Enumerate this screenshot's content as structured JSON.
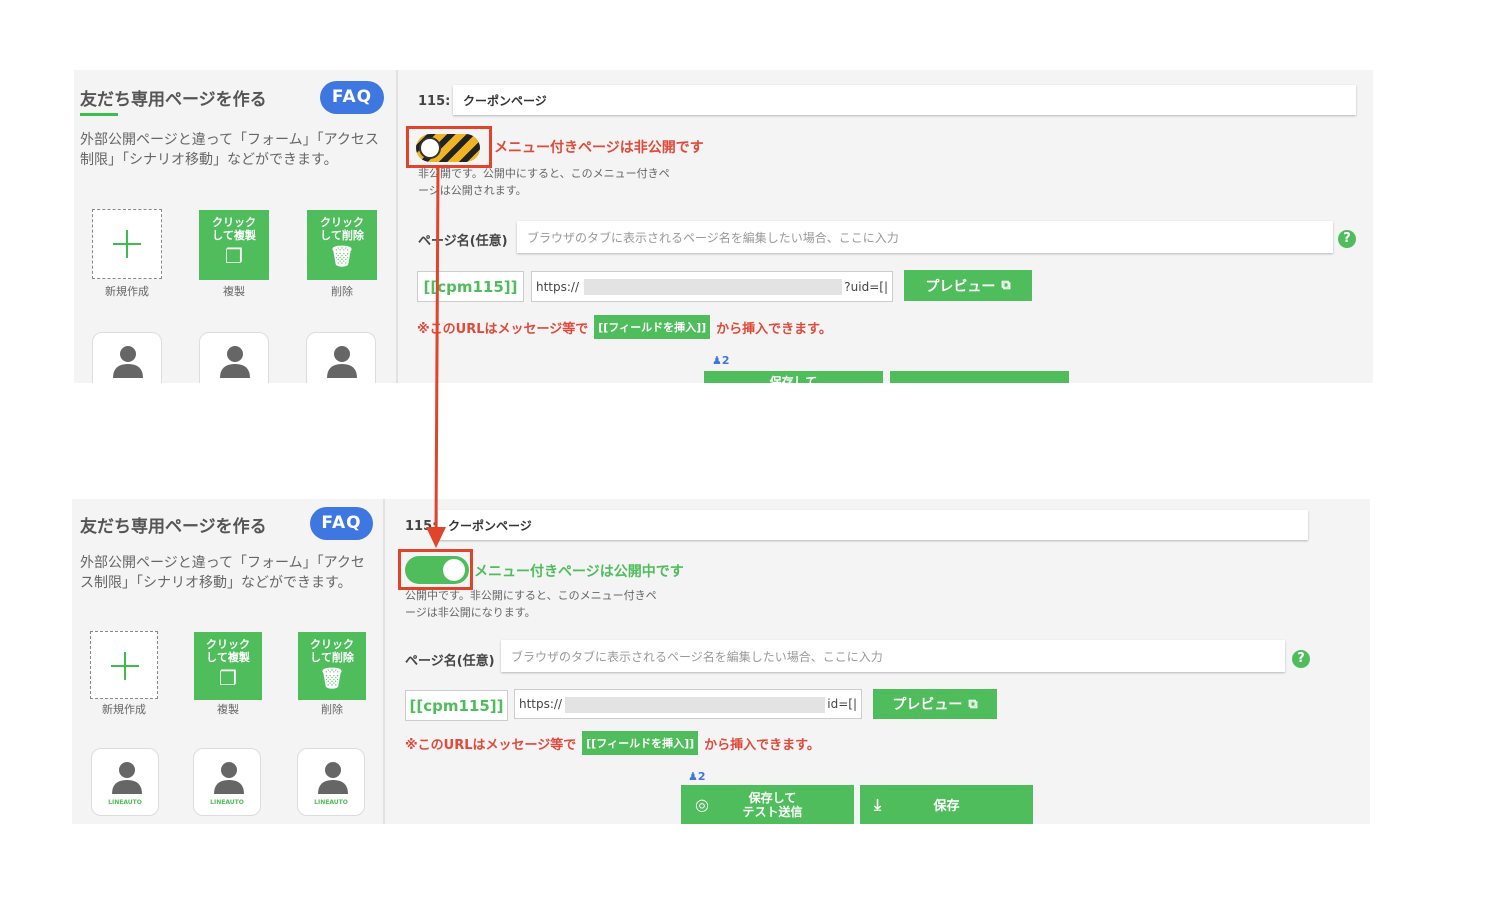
{
  "panels": [
    {
      "title": "友だち専用ページを作る",
      "faq": "FAQ",
      "description": "外部公開ページと違って「フォーム」「アクセス制限」「シナリオ移動」などができます。",
      "tiles": {
        "new": "新規作成",
        "copy_top": "クリック\nして複製",
        "copy": "複製",
        "delete_top": "クリック\nして削除",
        "delete": "削除"
      },
      "page_number": "115:",
      "page_title": "クーポンページ",
      "toggle_on": false,
      "state_text": "メニュー付きページは非公開です",
      "state_desc": "非公開です。公開中にすると、このメニュー付きページは公開されます。",
      "page_name_label": "ページ名(任意)",
      "page_name_placeholder": "ブラウザのタブに表示されるページ名を編集したい場合、ここに入力",
      "shortcode": "[[cpm115]]",
      "url_prefix": "https://",
      "url_suffix": "?uid=[|",
      "preview": "プレビュー",
      "notice_before": "※このURLはメッセージ等で",
      "notice_chip": "[[フィールドを挿入]]",
      "notice_after": "から挿入できます。",
      "user_count": "2",
      "save_test": "保存して",
      "avatar_brand": ""
    },
    {
      "title": "友だち専用ページを作る",
      "faq": "FAQ",
      "description": "外部公開ページと違って「フォーム」「アクセス制限」「シナリオ移動」などができます。",
      "tiles": {
        "new": "新規作成",
        "copy_top": "クリック\nして複製",
        "copy": "複製",
        "delete_top": "クリック\nして削除",
        "delete": "削除"
      },
      "page_number": "115:",
      "page_title": "クーポンページ",
      "toggle_on": true,
      "state_text": "メニュー付きページは公開中です",
      "state_desc": "公開中です。非公開にすると、このメニュー付きページは非公開になります。",
      "page_name_label": "ページ名(任意)",
      "page_name_placeholder": "ブラウザのタブに表示されるページ名を編集したい場合、ここに入力",
      "shortcode": "[[cpm115]]",
      "url_prefix": "https://",
      "url_suffix": "id=[|",
      "preview": "プレビュー",
      "notice_before": "※このURLはメッセージ等で",
      "notice_chip": "[[フィールドを挿入]]",
      "notice_after": "から挿入できます。",
      "user_count": "2",
      "save_test": "保存して\nテスト送信",
      "save": "保存",
      "avatar_brand": "LINEAUTO"
    }
  ],
  "colors": {
    "green": "#4fbd5c",
    "red": "#e04a3a",
    "blue": "#3f77e0",
    "highlight": "#e0452b",
    "disabled_toggle": "#f0b323"
  }
}
